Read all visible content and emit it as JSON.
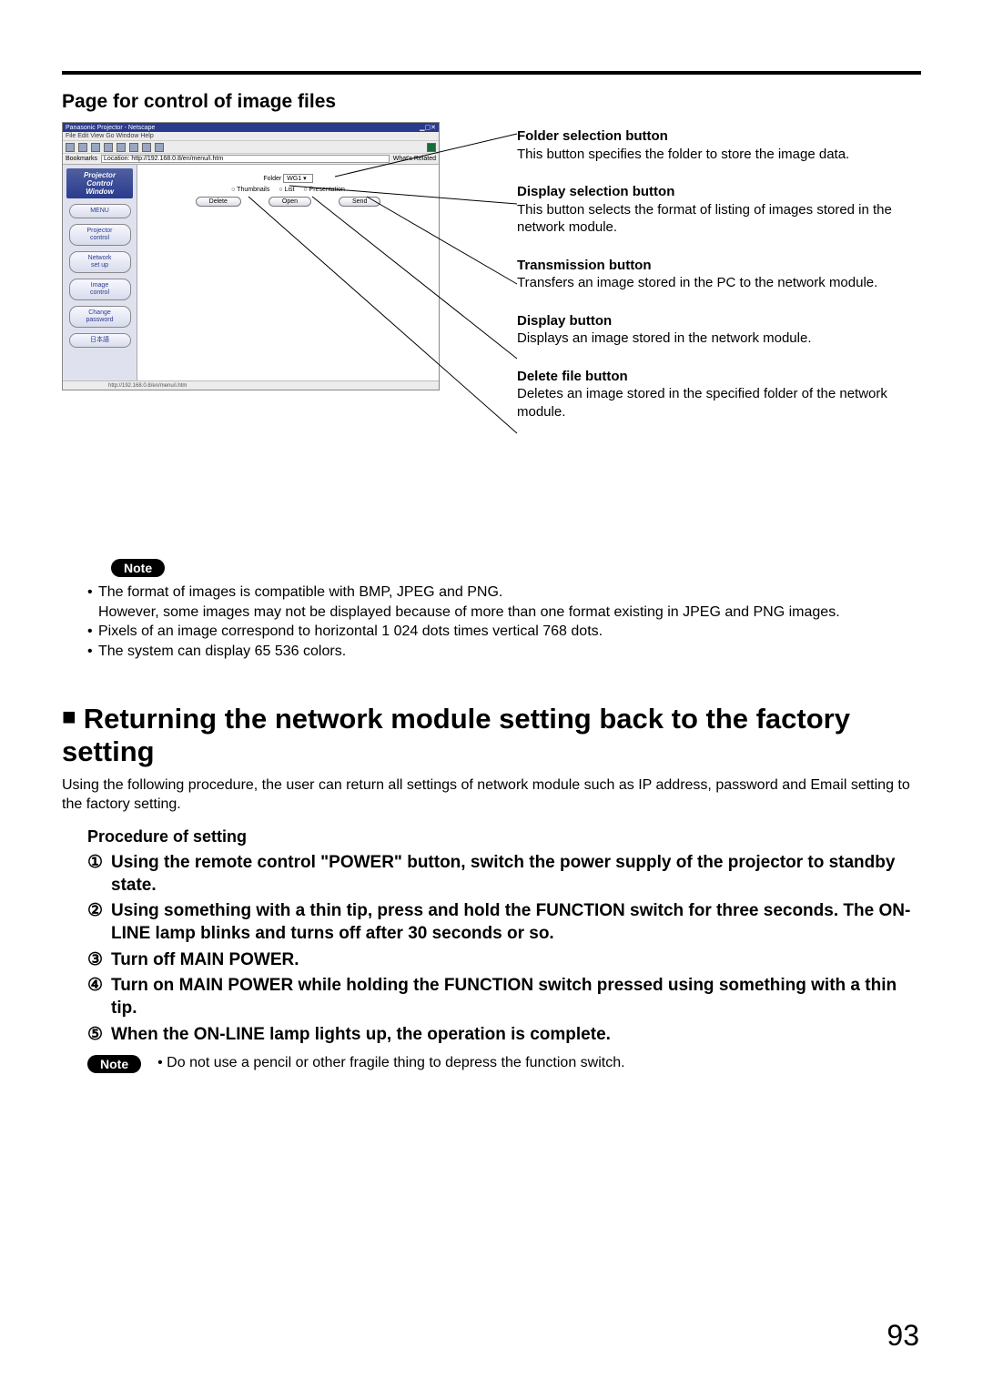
{
  "section_title": "Page for control of image files",
  "screenshot": {
    "title": "Panasonic Projector - Netscape",
    "menubar": "File  Edit  View  Go  Window  Help",
    "location_label": "Bookmarks",
    "location_url": "Location: http://192.168.0.8/en/menu/i.htm",
    "related": "What's Related",
    "pcw_line1": "Projector",
    "pcw_line2": "Control",
    "pcw_line3": "Window",
    "side": [
      "MENU",
      "Projector\ncontrol",
      "Network\nset up",
      "Image\ncontrol",
      "Change\npassword",
      "日本語"
    ],
    "folder_label": "Folder",
    "folder_value": "WG1",
    "radios": [
      "Thumbnails",
      "List",
      "Presentation"
    ],
    "buttons": [
      "Delete",
      "Open",
      "Send"
    ],
    "status": "http://192.168.0.8/en/menu/i.htm"
  },
  "annotations": [
    {
      "title": "Folder selection button",
      "body": "This button specifies the folder to store the image data."
    },
    {
      "title": "Display selection button",
      "body": "This button selects the format of listing of images stored in the network module."
    },
    {
      "title": "Transmission button",
      "body": "Transfers an image stored in the PC to the network module."
    },
    {
      "title": "Display button",
      "body": "Displays an image stored in the network module."
    },
    {
      "title": "Delete file button",
      "body": "Deletes an image stored in the specified folder of the network module."
    }
  ],
  "note_label": "Note",
  "notes": [
    "The format of images is compatible with BMP, JPEG and PNG.",
    "However, some images may not be displayed because of more than one format existing in JPEG and PNG images.",
    "Pixels of an image correspond to horizontal 1 024 dots times vertical 768 dots.",
    "The system can display 65 536 colors."
  ],
  "main_heading": "Returning the network module setting back to the factory setting",
  "intro": "Using the following procedure, the user can return all settings of network module such as IP address, password and Email setting to the factory setting.",
  "proc_title": "Procedure of setting",
  "steps": [
    "Using the remote control \"POWER\" button, switch the power supply of the projector to standby state.",
    "Using something with a thin tip, press and hold the FUNCTION switch for three seconds.  The ON-LINE lamp blinks and turns off after 30 seconds or so.",
    "Turn off MAIN POWER.",
    "Turn on MAIN POWER while holding the FUNCTION switch pressed using something with a thin tip.",
    "When the ON-LINE lamp lights up, the operation is complete."
  ],
  "circled": [
    "①",
    "②",
    "③",
    "④",
    "⑤"
  ],
  "bottom_note": "• Do not use a pencil or other fragile thing to depress the function switch.",
  "page_number": "93"
}
